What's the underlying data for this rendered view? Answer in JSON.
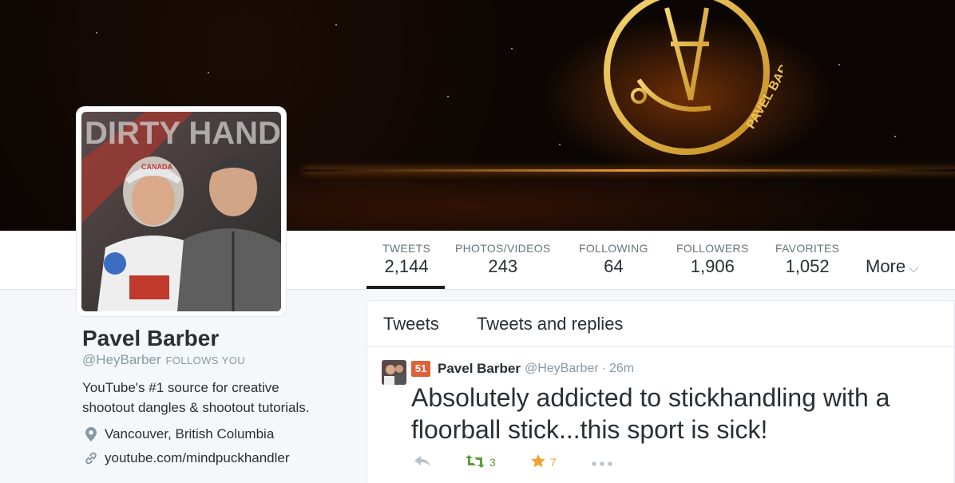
{
  "banner": {
    "logo_text": "PAVEL BARBER"
  },
  "avatar_image": {
    "overlay_text": "DIRTY HANDS",
    "cap_text": "CANADA"
  },
  "nav": {
    "stats": [
      {
        "label": "TWEETS",
        "value": "2,144",
        "active": true
      },
      {
        "label": "PHOTOS/VIDEOS",
        "value": "243",
        "active": false
      },
      {
        "label": "FOLLOWING",
        "value": "64",
        "active": false
      },
      {
        "label": "FOLLOWERS",
        "value": "1,906",
        "active": false
      },
      {
        "label": "FAVORITES",
        "value": "1,052",
        "active": false
      }
    ],
    "more_label": "More"
  },
  "profile": {
    "name": "Pavel Barber",
    "handle": "@HeyBarber",
    "follows_you": "FOLLOWS YOU",
    "bio_line1": "YouTube's #1 source for creative",
    "bio_line2": "shootout dangles & shootout tutorials.",
    "location": "Vancouver, British Columbia",
    "url": "youtube.com/mindpuckhandler"
  },
  "timeline": {
    "tabs": [
      "Tweets",
      "Tweets and replies"
    ],
    "tweet": {
      "badge": "51",
      "name": "Pavel Barber",
      "handle": "@HeyBarber",
      "separator": "·",
      "time": "26m",
      "text_line1": "Absolutely addicted to stickhandling with a",
      "text_line2": "floorball stick...this sport is sick!",
      "retweets": "3",
      "favorites": "7"
    }
  },
  "colors": {
    "retweet": "#5b9b3a",
    "favorite": "#f0a22e",
    "muted": "#b5c2cc"
  },
  "icons": [
    "reply-icon",
    "retweet-icon",
    "favorite-star-icon",
    "more-dots-icon",
    "location-pin-icon",
    "link-icon",
    "chevron-down-icon"
  ]
}
